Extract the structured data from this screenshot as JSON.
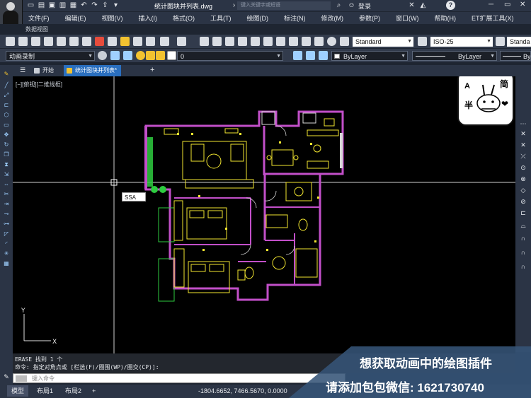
{
  "titlebar": {
    "title": "统计图块并列表.dwg",
    "search_placeholder": "键入关键字或短语",
    "login": "登录",
    "help": "?"
  },
  "menu": {
    "items": [
      "文件(F)",
      "编辑(E)",
      "视图(V)",
      "插入(I)",
      "格式(O)",
      "工具(T)",
      "绘图(D)",
      "标注(N)",
      "修改(M)",
      "参数(P)",
      "窗口(W)",
      "帮助(H)",
      "ET扩展工具(X)"
    ],
    "subtitle": "数据视图"
  },
  "toolbar1": {
    "text_style": "Standard",
    "dim_style": "ISO-25",
    "table_style": "Standa"
  },
  "toolbar2": {
    "workspace": "动画录制",
    "layer": "0",
    "color": "ByLayer",
    "linetype": "ByLayer",
    "lineweight": "By"
  },
  "tabs": {
    "start": "开始",
    "drawing": "统计图块并列表*"
  },
  "canvas": {
    "view_label": "[−][俯视][二维线框]",
    "cmd_input": "SSA"
  },
  "navwidget": {
    "a": "A",
    "ban": "半",
    "jian": "简",
    "heart": "❤"
  },
  "cmdline": {
    "line1": "ERASE 找到 1 个",
    "line2": "命令: 指定对角点或 [栏选(F)/圈围(WP)/圈交(CP)]:",
    "placeholder": "键入命令"
  },
  "statusbar": {
    "tabs": [
      "模型",
      "布局1",
      "布局2"
    ],
    "coords": "-1804.6652, 7466.5670, 0.0000"
  },
  "promo": {
    "line1": "想获取动画中的绘图插件",
    "line2": "请添加包包微信: 1621730740"
  },
  "colors": {
    "wall": "#c24fc9",
    "furniture": "#f2e630",
    "hatch": "#2ecc40",
    "window": "#d8d8d8",
    "accent": "#2a6fbf"
  }
}
